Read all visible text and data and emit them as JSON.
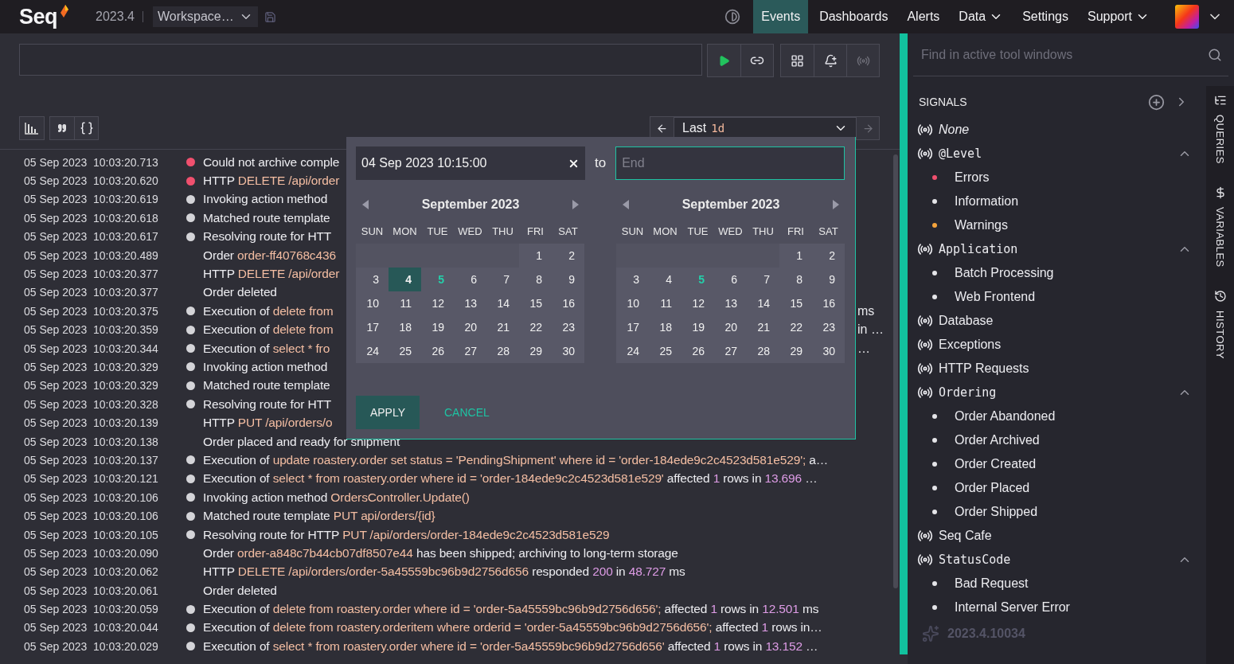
{
  "topbar": {
    "logo": "Seq",
    "version": "2023.4",
    "workspace": "Workspace…",
    "nav": [
      {
        "label": "Events",
        "selected": true,
        "menu": false
      },
      {
        "label": "Dashboards",
        "selected": false,
        "menu": false
      },
      {
        "label": "Alerts",
        "selected": false,
        "menu": false
      },
      {
        "label": "Data",
        "selected": false,
        "menu": true
      },
      {
        "label": "Settings",
        "selected": false,
        "menu": false
      },
      {
        "label": "Support",
        "selected": false,
        "menu": true
      }
    ]
  },
  "query": {
    "tool_buttons": [
      {
        "kind": "dashboard",
        "disabled": false
      },
      {
        "kind": "alert",
        "disabled": false
      },
      {
        "kind": "signal",
        "disabled": true
      }
    ]
  },
  "range": {
    "label": "Last",
    "value": "1d",
    "next_disabled": true
  },
  "events": [
    {
      "date": "05 Sep 2023",
      "time": "10:03:20.713",
      "color": "#f0506e",
      "covered": true,
      "message": [
        {
          "kind": "text",
          "text": "Could not archive comple"
        }
      ]
    },
    {
      "date": "05 Sep 2023",
      "time": "10:03:20.620",
      "color": "#f0506e",
      "covered": true,
      "message": [
        {
          "kind": "text",
          "text": "HTTP "
        },
        {
          "kind": "value",
          "text": "DELETE /api/order"
        }
      ]
    },
    {
      "date": "05 Sep 2023",
      "time": "10:03:20.619",
      "color": "#d4d4d8",
      "covered": true,
      "message": [
        {
          "kind": "text",
          "text": "Invoking action method"
        }
      ]
    },
    {
      "date": "05 Sep 2023",
      "time": "10:03:20.618",
      "color": "#d4d4d8",
      "covered": true,
      "message": [
        {
          "kind": "text",
          "text": "Matched route template"
        }
      ]
    },
    {
      "date": "05 Sep 2023",
      "time": "10:03:20.617",
      "color": "#d4d4d8",
      "covered": true,
      "message": [
        {
          "kind": "text",
          "text": "Resolving route for HTT"
        }
      ]
    },
    {
      "date": "05 Sep 2023",
      "time": "10:03:20.489",
      "covered": true,
      "message": [
        {
          "kind": "text",
          "text": "Order "
        },
        {
          "kind": "value",
          "text": "order-ff40768c436"
        }
      ]
    },
    {
      "date": "05 Sep 2023",
      "time": "10:03:20.377",
      "covered": true,
      "message": [
        {
          "kind": "text",
          "text": "HTTP "
        },
        {
          "kind": "value",
          "text": "DELETE /api/order"
        }
      ]
    },
    {
      "date": "05 Sep 2023",
      "time": "10:03:20.377",
      "covered": true,
      "message": [
        {
          "kind": "text",
          "text": "Order deleted"
        }
      ]
    },
    {
      "date": "05 Sep 2023",
      "time": "10:03:20.375",
      "color": "#d4d4d8",
      "covered": true,
      "message": [
        {
          "kind": "text",
          "text": "Execution of "
        },
        {
          "kind": "value",
          "text": "delete from"
        }
      ],
      "tail": "ms"
    },
    {
      "date": "05 Sep 2023",
      "time": "10:03:20.359",
      "color": "#d4d4d8",
      "covered": true,
      "message": [
        {
          "kind": "text",
          "text": "Execution of "
        },
        {
          "kind": "value",
          "text": "delete from"
        }
      ],
      "tail": "in …"
    },
    {
      "date": "05 Sep 2023",
      "time": "10:03:20.344",
      "color": "#d4d4d8",
      "covered": true,
      "message": [
        {
          "kind": "text",
          "text": "Execution of "
        },
        {
          "kind": "value",
          "text": "select * fro"
        }
      ],
      "tail": "…"
    },
    {
      "date": "05 Sep 2023",
      "time": "10:03:20.329",
      "color": "#d4d4d8",
      "covered": true,
      "message": [
        {
          "kind": "text",
          "text": "Invoking action method"
        }
      ]
    },
    {
      "date": "05 Sep 2023",
      "time": "10:03:20.329",
      "color": "#d4d4d8",
      "covered": true,
      "message": [
        {
          "kind": "text",
          "text": "Matched route template"
        }
      ]
    },
    {
      "date": "05 Sep 2023",
      "time": "10:03:20.328",
      "color": "#d4d4d8",
      "covered": true,
      "message": [
        {
          "kind": "text",
          "text": "Resolving route for HTT"
        }
      ]
    },
    {
      "date": "05 Sep 2023",
      "time": "10:03:20.139",
      "covered": true,
      "message": [
        {
          "kind": "text",
          "text": "HTTP "
        },
        {
          "kind": "value",
          "text": "PUT /api/orders/o"
        }
      ]
    },
    {
      "date": "05 Sep 2023",
      "time": "10:03:20.138",
      "covered": false,
      "message": [
        {
          "kind": "text",
          "text": "Order placed and ready for shipment"
        }
      ]
    },
    {
      "date": "05 Sep 2023",
      "time": "10:03:20.137",
      "color": "#d4d4d8",
      "covered": false,
      "message": [
        {
          "kind": "text",
          "text": "Execution of "
        },
        {
          "kind": "value",
          "text": "update roastery.order set status = 'PendingShipment' where id = 'order-184ede9c2c4523d581e529';"
        },
        {
          "kind": "text",
          "text": " a…"
        }
      ]
    },
    {
      "date": "05 Sep 2023",
      "time": "10:03:20.121",
      "color": "#d4d4d8",
      "covered": false,
      "message": [
        {
          "kind": "text",
          "text": "Execution of "
        },
        {
          "kind": "value",
          "text": "select * from roastery.order where id = 'order-184ede9c2c4523d581e529'"
        },
        {
          "kind": "text",
          "text": " affected "
        },
        {
          "kind": "number",
          "text": "1"
        },
        {
          "kind": "text",
          "text": " rows in "
        },
        {
          "kind": "number",
          "text": "13.696"
        },
        {
          "kind": "text",
          "text": " …"
        }
      ]
    },
    {
      "date": "05 Sep 2023",
      "time": "10:03:20.106",
      "color": "#d4d4d8",
      "covered": false,
      "message": [
        {
          "kind": "text",
          "text": "Invoking action method "
        },
        {
          "kind": "value",
          "text": "OrdersController.Update()"
        }
      ]
    },
    {
      "date": "05 Sep 2023",
      "time": "10:03:20.106",
      "color": "#d4d4d8",
      "covered": false,
      "message": [
        {
          "kind": "text",
          "text": "Matched route template "
        },
        {
          "kind": "value",
          "text": "PUT api/orders/{id}"
        }
      ]
    },
    {
      "date": "05 Sep 2023",
      "time": "10:03:20.105",
      "color": "#d4d4d8",
      "covered": false,
      "message": [
        {
          "kind": "text",
          "text": "Resolving route for HTTP "
        },
        {
          "kind": "value",
          "text": "PUT /api/orders/order-184ede9c2c4523d581e529"
        }
      ]
    },
    {
      "date": "05 Sep 2023",
      "time": "10:03:20.090",
      "covered": false,
      "message": [
        {
          "kind": "text",
          "text": "Order "
        },
        {
          "kind": "value",
          "text": "order-a848c7b44cb07df8507e44"
        },
        {
          "kind": "text",
          "text": " has been shipped; archiving to long-term storage"
        }
      ]
    },
    {
      "date": "05 Sep 2023",
      "time": "10:03:20.062",
      "covered": false,
      "message": [
        {
          "kind": "text",
          "text": "HTTP "
        },
        {
          "kind": "value",
          "text": "DELETE /api/orders/order-5a45559bc96b9d2756d656"
        },
        {
          "kind": "text",
          "text": " responded "
        },
        {
          "kind": "number",
          "text": "200"
        },
        {
          "kind": "text",
          "text": " in "
        },
        {
          "kind": "number",
          "text": "48.727"
        },
        {
          "kind": "text",
          "text": " ms"
        }
      ]
    },
    {
      "date": "05 Sep 2023",
      "time": "10:03:20.061",
      "covered": false,
      "message": [
        {
          "kind": "text",
          "text": "Order deleted"
        }
      ]
    },
    {
      "date": "05 Sep 2023",
      "time": "10:03:20.059",
      "color": "#d4d4d8",
      "covered": false,
      "message": [
        {
          "kind": "text",
          "text": "Execution of "
        },
        {
          "kind": "value",
          "text": "delete from roastery.order where id = 'order-5a45559bc96b9d2756d656';"
        },
        {
          "kind": "text",
          "text": " affected "
        },
        {
          "kind": "number",
          "text": "1"
        },
        {
          "kind": "text",
          "text": " rows in "
        },
        {
          "kind": "number",
          "text": "12.501"
        },
        {
          "kind": "text",
          "text": " ms"
        }
      ]
    },
    {
      "date": "05 Sep 2023",
      "time": "10:03:20.044",
      "color": "#d4d4d8",
      "covered": false,
      "message": [
        {
          "kind": "text",
          "text": "Execution of "
        },
        {
          "kind": "value",
          "text": "delete from roastery.orderitem where orderid = 'order-5a45559bc96b9d2756d656';"
        },
        {
          "kind": "text",
          "text": " affected "
        },
        {
          "kind": "number",
          "text": "1"
        },
        {
          "kind": "text",
          "text": " rows in…"
        }
      ]
    },
    {
      "date": "05 Sep 2023",
      "time": "10:03:20.029",
      "color": "#d4d4d8",
      "covered": false,
      "message": [
        {
          "kind": "text",
          "text": "Execution of "
        },
        {
          "kind": "value",
          "text": "select * from roastery.order where id = 'order-5a45559bc96b9d2756d656'"
        },
        {
          "kind": "text",
          "text": " affected "
        },
        {
          "kind": "number",
          "text": "1"
        },
        {
          "kind": "text",
          "text": " rows in "
        },
        {
          "kind": "number",
          "text": "13.152"
        },
        {
          "kind": "text",
          "text": " …"
        }
      ]
    }
  ],
  "date_picker": {
    "start": {
      "value": "04 Sep 2023 10:15:00"
    },
    "separator": "to",
    "end": {
      "placeholder": "End",
      "focused": true
    },
    "calendars": [
      {
        "title": "September 2023",
        "weekdays": [
          "SUN",
          "MON",
          "TUE",
          "WED",
          "THU",
          "FRI",
          "SAT"
        ],
        "days": [
          {
            "kind": "blank"
          },
          {
            "kind": "blank"
          },
          {
            "kind": "blank"
          },
          {
            "kind": "blank"
          },
          {
            "kind": "blank"
          },
          {
            "kind": "day",
            "label": "1",
            "selected": false,
            "today": false
          },
          {
            "kind": "day",
            "label": "2",
            "selected": false,
            "today": false
          },
          {
            "kind": "day",
            "label": "3",
            "selected": false,
            "today": false
          },
          {
            "kind": "day",
            "label": "4",
            "selected": true,
            "today": false
          },
          {
            "kind": "day",
            "label": "5",
            "selected": false,
            "today": true
          },
          {
            "kind": "day",
            "label": "6",
            "selected": false,
            "today": false
          },
          {
            "kind": "day",
            "label": "7",
            "selected": false,
            "today": false
          },
          {
            "kind": "day",
            "label": "8",
            "selected": false,
            "today": false
          },
          {
            "kind": "day",
            "label": "9",
            "selected": false,
            "today": false
          },
          {
            "kind": "day",
            "label": "10",
            "selected": false,
            "today": false
          },
          {
            "kind": "day",
            "label": "11",
            "selected": false,
            "today": false
          },
          {
            "kind": "day",
            "label": "12",
            "selected": false,
            "today": false
          },
          {
            "kind": "day",
            "label": "13",
            "selected": false,
            "today": false
          },
          {
            "kind": "day",
            "label": "14",
            "selected": false,
            "today": false
          },
          {
            "kind": "day",
            "label": "15",
            "selected": false,
            "today": false
          },
          {
            "kind": "day",
            "label": "16",
            "selected": false,
            "today": false
          },
          {
            "kind": "day",
            "label": "17",
            "selected": false,
            "today": false
          },
          {
            "kind": "day",
            "label": "18",
            "selected": false,
            "today": false
          },
          {
            "kind": "day",
            "label": "19",
            "selected": false,
            "today": false
          },
          {
            "kind": "day",
            "label": "20",
            "selected": false,
            "today": false
          },
          {
            "kind": "day",
            "label": "21",
            "selected": false,
            "today": false
          },
          {
            "kind": "day",
            "label": "22",
            "selected": false,
            "today": false
          },
          {
            "kind": "day",
            "label": "23",
            "selected": false,
            "today": false
          },
          {
            "kind": "day",
            "label": "24",
            "selected": false,
            "today": false
          },
          {
            "kind": "day",
            "label": "25",
            "selected": false,
            "today": false
          },
          {
            "kind": "day",
            "label": "26",
            "selected": false,
            "today": false
          },
          {
            "kind": "day",
            "label": "27",
            "selected": false,
            "today": false
          },
          {
            "kind": "day",
            "label": "28",
            "selected": false,
            "today": false
          },
          {
            "kind": "day",
            "label": "29",
            "selected": false,
            "today": false
          },
          {
            "kind": "day",
            "label": "30",
            "selected": false,
            "today": false
          }
        ]
      },
      {
        "title": "September 2023",
        "weekdays": [
          "SUN",
          "MON",
          "TUE",
          "WED",
          "THU",
          "FRI",
          "SAT"
        ],
        "days": [
          {
            "kind": "blank"
          },
          {
            "kind": "blank"
          },
          {
            "kind": "blank"
          },
          {
            "kind": "blank"
          },
          {
            "kind": "blank"
          },
          {
            "kind": "day",
            "label": "1",
            "selected": false,
            "today": false
          },
          {
            "kind": "day",
            "label": "2",
            "selected": false,
            "today": false
          },
          {
            "kind": "day",
            "label": "3",
            "selected": false,
            "today": false
          },
          {
            "kind": "day",
            "label": "4",
            "selected": false,
            "today": false
          },
          {
            "kind": "day",
            "label": "5",
            "selected": false,
            "today": true
          },
          {
            "kind": "day",
            "label": "6",
            "selected": false,
            "today": false
          },
          {
            "kind": "day",
            "label": "7",
            "selected": false,
            "today": false
          },
          {
            "kind": "day",
            "label": "8",
            "selected": false,
            "today": false
          },
          {
            "kind": "day",
            "label": "9",
            "selected": false,
            "today": false
          },
          {
            "kind": "day",
            "label": "10",
            "selected": false,
            "today": false
          },
          {
            "kind": "day",
            "label": "11",
            "selected": false,
            "today": false
          },
          {
            "kind": "day",
            "label": "12",
            "selected": false,
            "today": false
          },
          {
            "kind": "day",
            "label": "13",
            "selected": false,
            "today": false
          },
          {
            "kind": "day",
            "label": "14",
            "selected": false,
            "today": false
          },
          {
            "kind": "day",
            "label": "15",
            "selected": false,
            "today": false
          },
          {
            "kind": "day",
            "label": "16",
            "selected": false,
            "today": false
          },
          {
            "kind": "day",
            "label": "17",
            "selected": false,
            "today": false
          },
          {
            "kind": "day",
            "label": "18",
            "selected": false,
            "today": false
          },
          {
            "kind": "day",
            "label": "19",
            "selected": false,
            "today": false
          },
          {
            "kind": "day",
            "label": "20",
            "selected": false,
            "today": false
          },
          {
            "kind": "day",
            "label": "21",
            "selected": false,
            "today": false
          },
          {
            "kind": "day",
            "label": "22",
            "selected": false,
            "today": false
          },
          {
            "kind": "day",
            "label": "23",
            "selected": false,
            "today": false
          },
          {
            "kind": "day",
            "label": "24",
            "selected": false,
            "today": false
          },
          {
            "kind": "day",
            "label": "25",
            "selected": false,
            "today": false
          },
          {
            "kind": "day",
            "label": "26",
            "selected": false,
            "today": false
          },
          {
            "kind": "day",
            "label": "27",
            "selected": false,
            "today": false
          },
          {
            "kind": "day",
            "label": "28",
            "selected": false,
            "today": false
          },
          {
            "kind": "day",
            "label": "29",
            "selected": false,
            "today": false
          },
          {
            "kind": "day",
            "label": "30",
            "selected": false,
            "today": false
          }
        ]
      }
    ],
    "apply": "APPLY",
    "cancel": "CANCEL"
  },
  "sidebar": {
    "find": {
      "placeholder": "Find in active tool windows"
    },
    "signals": {
      "title": "SIGNALS",
      "items": [
        {
          "kind": "none",
          "label": "None"
        },
        {
          "kind": "property",
          "label": "@Level",
          "expanded": true,
          "children": [
            {
              "label": "Errors",
              "color": "#f0506e"
            },
            {
              "label": "Information",
              "color": "#e4e4e8"
            },
            {
              "label": "Warnings",
              "color": "#f5a33c"
            }
          ]
        },
        {
          "kind": "property",
          "label": "Application",
          "expanded": true,
          "children": [
            {
              "label": "Batch Processing",
              "color": "#e4e4e8"
            },
            {
              "label": "Web Frontend",
              "color": "#e4e4e8"
            }
          ]
        },
        {
          "kind": "signal",
          "label": "Database"
        },
        {
          "kind": "signal",
          "label": "Exceptions"
        },
        {
          "kind": "signal",
          "label": "HTTP Requests"
        },
        {
          "kind": "property",
          "label": "Ordering",
          "expanded": true,
          "children": [
            {
              "label": "Order Abandoned",
              "color": "#e4e4e8"
            },
            {
              "label": "Order Archived",
              "color": "#e4e4e8"
            },
            {
              "label": "Order Created",
              "color": "#e4e4e8"
            },
            {
              "label": "Order Placed",
              "color": "#e4e4e8"
            },
            {
              "label": "Order Shipped",
              "color": "#e4e4e8"
            }
          ]
        },
        {
          "kind": "signal",
          "label": "Seq Cafe"
        },
        {
          "kind": "property",
          "label": "StatusCode",
          "expanded": true,
          "children": [
            {
              "label": "Bad Request",
              "color": "#e4e4e8"
            },
            {
              "label": "Internal Server Error",
              "color": "#e4e4e8"
            }
          ]
        }
      ]
    },
    "tool_tabs": [
      {
        "kind": "queries",
        "label": "QUERIES"
      },
      {
        "kind": "variables",
        "label": "VARIABLES"
      },
      {
        "kind": "history",
        "label": "HISTORY"
      }
    ],
    "build": "2023.4.10034"
  }
}
